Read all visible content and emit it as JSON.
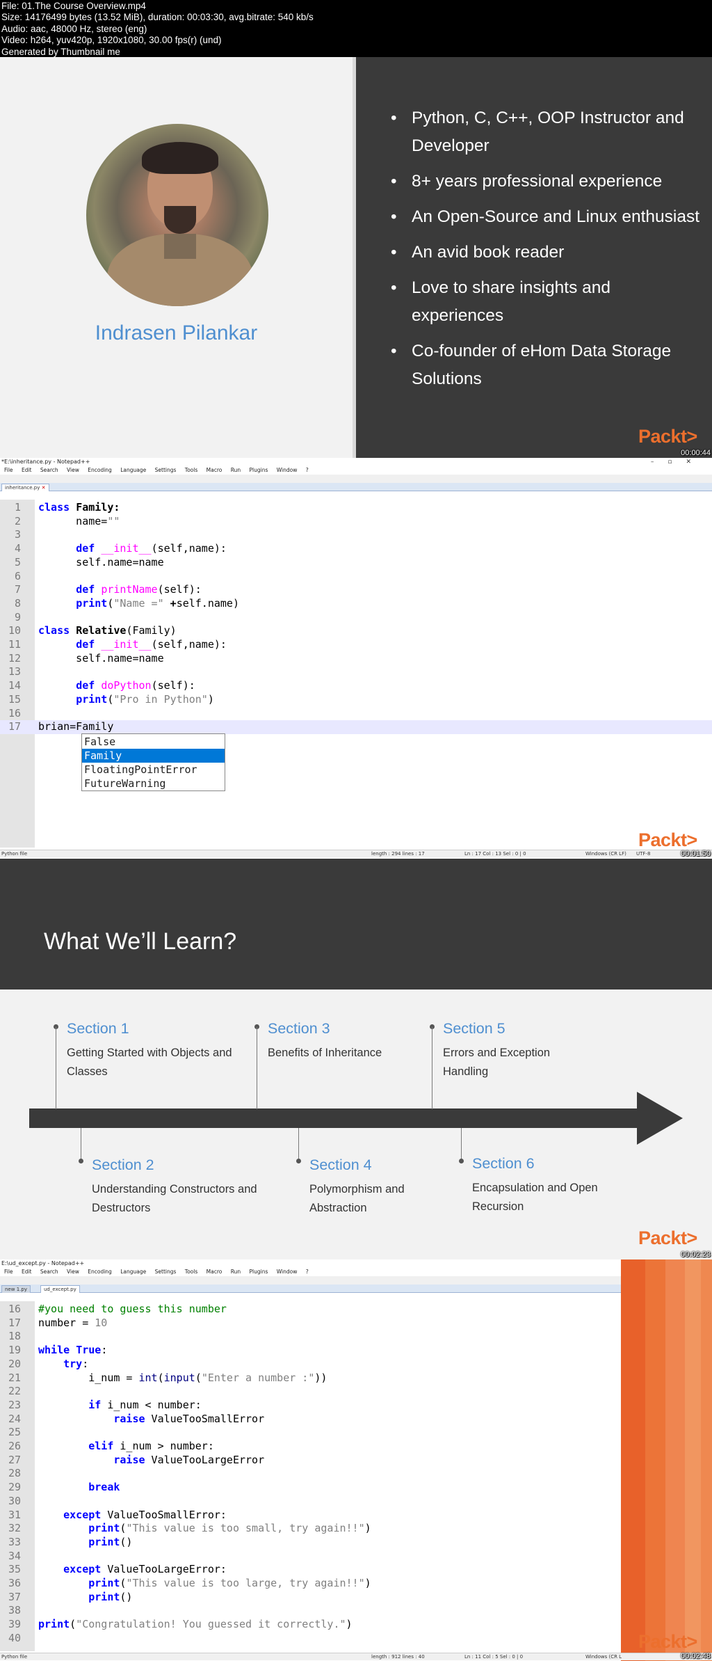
{
  "header": {
    "lines": [
      "File: 01.The Course Overview.mp4",
      "Size: 14176499 bytes (13.52 MiB), duration: 00:03:30, avg.bitrate: 540 kb/s",
      "Audio: aac, 48000 Hz, stereo (eng)",
      "Video: h264, yuv420p, 1920x1080, 30.00 fps(r) (und)",
      "Generated by Thumbnail me"
    ]
  },
  "frame1": {
    "name": "Indrasen Pilankar",
    "bullets": [
      "Python, C, C++, OOP Instructor and Developer",
      "8+ years professional experience",
      "An Open-Source and Linux enthusiast",
      "An avid book reader",
      "Love to share insights and experiences",
      "Co-founder of eHom Data Storage Solutions"
    ],
    "logo": "Packt>",
    "timestamp": "00:00:44"
  },
  "frame2": {
    "title": "*E:\\inheritance.py - Notepad++",
    "menu": [
      "File",
      "Edit",
      "Search",
      "View",
      "Encoding",
      "Language",
      "Settings",
      "Tools",
      "Macro",
      "Run",
      "Plugins",
      "Window",
      "?"
    ],
    "tab": "inheritance.py",
    "lines": [
      {
        "n": "1",
        "html": "<span class='kw'>class</span> <span class='op'>Family:</span>"
      },
      {
        "n": "2",
        "html": "      name=<span class='st'>\"\"</span>"
      },
      {
        "n": "3",
        "html": ""
      },
      {
        "n": "4",
        "html": "      <span class='kw'>def</span> <span class='fn'>__init__</span>(self,name):"
      },
      {
        "n": "5",
        "html": "      self.name=name"
      },
      {
        "n": "6",
        "html": ""
      },
      {
        "n": "7",
        "html": "      <span class='kw'>def</span> <span class='fn'>printName</span>(self):"
      },
      {
        "n": "8",
        "html": "      <span class='kw'>print</span>(<span class='st'>\"Name =\"</span> <span class='op'>+</span>self.name)"
      },
      {
        "n": "9",
        "html": ""
      },
      {
        "n": "10",
        "html": "<span class='kw'>class</span> <span class='op'>Relative</span>(Family)"
      },
      {
        "n": "11",
        "html": "      <span class='kw'>def</span> <span class='fn'>__init__</span>(self,name):"
      },
      {
        "n": "12",
        "html": "      self.name=name"
      },
      {
        "n": "13",
        "html": ""
      },
      {
        "n": "14",
        "html": "      <span class='kw'>def</span> <span class='fn'>doPython</span>(self):"
      },
      {
        "n": "15",
        "html": "      <span class='kw'>print</span>(<span class='st'>\"Pro in Python\"</span>)"
      },
      {
        "n": "16",
        "html": ""
      },
      {
        "n": "17",
        "html": "brian=Family"
      }
    ],
    "autocomplete": [
      "False",
      "Family",
      "FloatingPointError",
      "FutureWarning"
    ],
    "autocomplete_selected": "Family",
    "status": {
      "left": "Python file",
      "length": "length : 294    lines : 17",
      "pos": "Ln : 17    Col : 13    Sel : 0 | 0",
      "eol": "Windows (CR LF)",
      "enc": "UTF-8"
    },
    "logo": "Packt>",
    "timestamp": "00:01:50"
  },
  "frame3": {
    "title": "What We’ll Learn?",
    "sections": [
      {
        "title": "Section 1",
        "desc": "Getting Started with Objects and Classes"
      },
      {
        "title": "Section 2",
        "desc": "Understanding Constructors and Destructors"
      },
      {
        "title": "Section 3",
        "desc": "Benefits of Inheritance"
      },
      {
        "title": "Section 4",
        "desc": "Polymorphism and Abstraction"
      },
      {
        "title": "Section 5",
        "desc": "Errors and Exception Handling"
      },
      {
        "title": "Section 6",
        "desc": "Encapsulation and Open Recursion"
      }
    ],
    "logo": "Packt>",
    "timestamp": "00:02:23"
  },
  "frame4": {
    "title": "E:\\ud_except.py - Notepad++",
    "tabs": [
      "new 1.py",
      "ud_except.py"
    ],
    "lines": [
      {
        "n": "16",
        "html": "<span class='cm'>#you need to guess this number</span>"
      },
      {
        "n": "17",
        "html": "number = <span class='st'>10</span>"
      },
      {
        "n": "18",
        "html": ""
      },
      {
        "n": "19",
        "html": "<span class='kw'>while</span> <span class='kw'>True</span>:"
      },
      {
        "n": "20",
        "html": "    <span class='kw'>try</span>:"
      },
      {
        "n": "21",
        "html": "        i_num = <span class='bi'>int</span>(<span class='bi'>input</span>(<span class='st'>\"Enter a number :\"</span>))"
      },
      {
        "n": "22",
        "html": ""
      },
      {
        "n": "23",
        "html": "        <span class='kw'>if</span> i_num < number:"
      },
      {
        "n": "24",
        "html": "            <span class='kw'>raise</span> ValueTooSmallError"
      },
      {
        "n": "25",
        "html": ""
      },
      {
        "n": "26",
        "html": "        <span class='kw'>elif</span> i_num > number:"
      },
      {
        "n": "27",
        "html": "            <span class='kw'>raise</span> ValueTooLargeError"
      },
      {
        "n": "28",
        "html": ""
      },
      {
        "n": "29",
        "html": "        <span class='kw'>break</span>"
      },
      {
        "n": "30",
        "html": ""
      },
      {
        "n": "31",
        "html": "    <span class='kw'>except</span> ValueTooSmallError:"
      },
      {
        "n": "32",
        "html": "        <span class='kw'>print</span>(<span class='st'>\"This value is too small, try again!!\"</span>)"
      },
      {
        "n": "33",
        "html": "        <span class='kw'>print</span>()"
      },
      {
        "n": "34",
        "html": ""
      },
      {
        "n": "35",
        "html": "    <span class='kw'>except</span> ValueTooLargeError:"
      },
      {
        "n": "36",
        "html": "        <span class='kw'>print</span>(<span class='st'>\"This value is too large, try again!!\"</span>)"
      },
      {
        "n": "37",
        "html": "        <span class='kw'>print</span>()"
      },
      {
        "n": "38",
        "html": ""
      },
      {
        "n": "39",
        "html": "<span class='kw'>print</span>(<span class='st'>\"Congratulation! You guessed it correctly.\"</span>)"
      },
      {
        "n": "40",
        "html": ""
      }
    ],
    "status": {
      "left": "Python file",
      "length": "length : 912    lines : 40",
      "pos": "Ln : 11    Col : 5    Sel : 0 | 0",
      "eol": "Windows (CR L"
    },
    "logo": "Packt>",
    "timestamp": "00:02:48"
  }
}
